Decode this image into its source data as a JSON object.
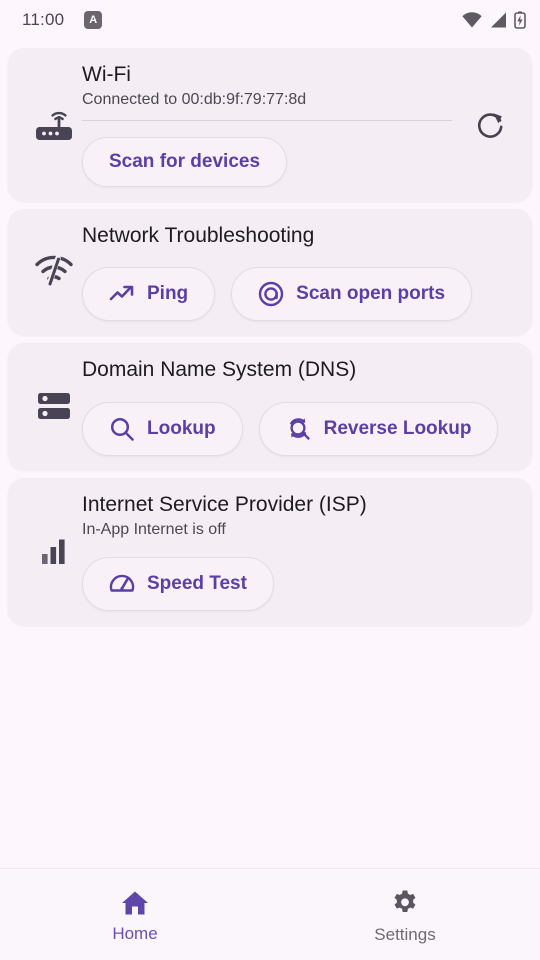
{
  "status_bar": {
    "time": "11:00",
    "badge_label": "A",
    "badge_icon": "accessibility-badge-icon",
    "icons": [
      "wifi-icon",
      "cellular-signal-icon",
      "battery-charging-icon"
    ]
  },
  "theme": {
    "background": "#fdf7fd",
    "card_background": "#f4eef4",
    "accent": "#5b3fa6",
    "icon_dark": "#494453",
    "nav_active": "#6a4fb3",
    "nav_inactive": "#6f6a74"
  },
  "cards": [
    {
      "id": "wifi",
      "icon": "router-icon",
      "title": "Wi-Fi",
      "subtitle": "Connected to 00:db:9f:79:77:8d",
      "has_divider": true,
      "buttons": [
        {
          "label": "Scan for devices",
          "icon": null
        }
      ],
      "action_icon": "refresh-icon"
    },
    {
      "id": "network-troubleshooting",
      "icon": "network-check-icon",
      "title": "Network Troubleshooting",
      "subtitle": null,
      "has_divider": false,
      "buttons": [
        {
          "label": "Ping",
          "icon": "trending-up-icon"
        },
        {
          "label": "Scan open ports",
          "icon": "target-icon"
        }
      ],
      "action_icon": null
    },
    {
      "id": "dns",
      "icon": "dns-server-icon",
      "title": "Domain Name System (DNS)",
      "subtitle": null,
      "has_divider": false,
      "buttons": [
        {
          "label": "Lookup",
          "icon": "search-icon"
        },
        {
          "label": "Reverse Lookup",
          "icon": "reverse-search-icon"
        }
      ],
      "action_icon": null
    },
    {
      "id": "isp",
      "icon": "signal-bars-icon",
      "title": "Internet Service Provider (ISP)",
      "subtitle": "In-App Internet is off",
      "has_divider": false,
      "buttons": [
        {
          "label": "Speed Test",
          "icon": "speedometer-icon"
        }
      ],
      "action_icon": null
    }
  ],
  "bottom_nav": {
    "items": [
      {
        "id": "home",
        "label": "Home",
        "icon": "home-icon",
        "active": true
      },
      {
        "id": "settings",
        "label": "Settings",
        "icon": "gear-icon",
        "active": false
      }
    ]
  }
}
